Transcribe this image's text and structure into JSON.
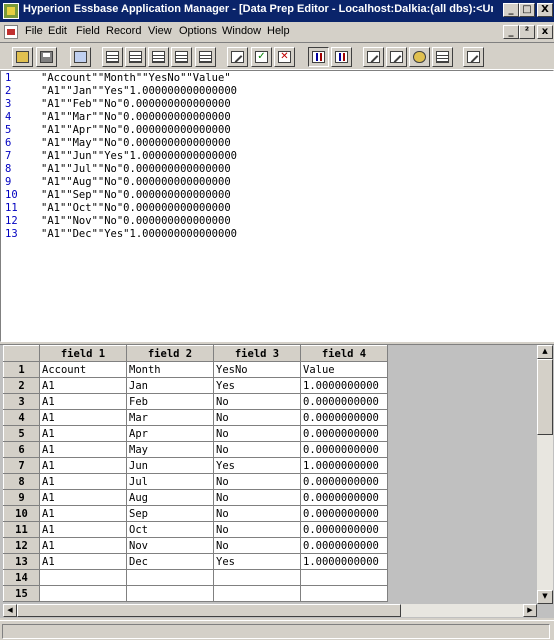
{
  "window": {
    "title": "Hyperion Essbase Application Manager - [Data Prep Editor - Localhost:Dalkia:(all dbs):<Untitle...",
    "controls": {
      "minimize": "_",
      "maximize": "□",
      "close": "X"
    }
  },
  "menubar": {
    "items": [
      "File",
      "Edit",
      "Field",
      "Record",
      "View",
      "Options",
      "Window",
      "Help"
    ],
    "mdi_controls": {
      "minimize": "_",
      "restore": "²",
      "close": "x"
    }
  },
  "toolbar": {
    "buttons": [
      {
        "name": "open-file-button",
        "icon": "open-icon"
      },
      {
        "name": "save-file-button",
        "icon": "save-icon"
      },
      {
        "name": "dimension-build-button",
        "icon": "filter-icon"
      },
      {
        "name": "record-view-button",
        "icon": "grid-icon"
      },
      {
        "name": "field-view-button",
        "icon": "grid-icon"
      },
      {
        "name": "column-view-button",
        "icon": "grid-icon"
      },
      {
        "name": "data-view-button",
        "icon": "grid-icon"
      },
      {
        "name": "edit-properties-button",
        "icon": "edit-icon"
      },
      {
        "name": "validate-button",
        "icon": "check-icon"
      },
      {
        "name": "clear-button",
        "icon": "x-icon"
      },
      {
        "name": "sort-button",
        "icon": "sort-icon"
      },
      {
        "name": "join-fields-button",
        "icon": "sort-icon"
      },
      {
        "name": "field-properties-button",
        "icon": "edit-icon"
      },
      {
        "name": "replace-button",
        "icon": "edit-icon"
      },
      {
        "name": "associate-outline-button",
        "icon": "gold-icon"
      },
      {
        "name": "data-load-settings-button",
        "icon": "grid-icon"
      },
      {
        "name": "help-button",
        "icon": "edit-icon"
      }
    ]
  },
  "text_pane": {
    "lines": [
      {
        "num": "1",
        "text": "\"Account\"\"Month\"\"YesNo\"\"Value\""
      },
      {
        "num": "2",
        "text": "\"A1\"\"Jan\"\"Yes\"1.000000000000000"
      },
      {
        "num": "3",
        "text": "\"A1\"\"Feb\"\"No\"0.000000000000000"
      },
      {
        "num": "4",
        "text": "\"A1\"\"Mar\"\"No\"0.000000000000000"
      },
      {
        "num": "5",
        "text": "\"A1\"\"Apr\"\"No\"0.000000000000000"
      },
      {
        "num": "6",
        "text": "\"A1\"\"May\"\"No\"0.000000000000000"
      },
      {
        "num": "7",
        "text": "\"A1\"\"Jun\"\"Yes\"1.000000000000000"
      },
      {
        "num": "8",
        "text": "\"A1\"\"Jul\"\"No\"0.000000000000000"
      },
      {
        "num": "9",
        "text": "\"A1\"\"Aug\"\"No\"0.000000000000000"
      },
      {
        "num": "10",
        "text": "\"A1\"\"Sep\"\"No\"0.000000000000000"
      },
      {
        "num": "11",
        "text": "\"A1\"\"Oct\"\"No\"0.000000000000000"
      },
      {
        "num": "12",
        "text": "\"A1\"\"Nov\"\"No\"0.000000000000000"
      },
      {
        "num": "13",
        "text": "\"A1\"\"Dec\"\"Yes\"1.000000000000000"
      }
    ]
  },
  "grid": {
    "columns": [
      "field 1",
      "field 2",
      "field 3",
      "field 4"
    ],
    "rows": [
      {
        "num": "1",
        "cells": [
          "Account",
          "Month",
          "YesNo",
          "Value"
        ]
      },
      {
        "num": "2",
        "cells": [
          "A1",
          "Jan",
          "Yes",
          "1.0000000000"
        ]
      },
      {
        "num": "3",
        "cells": [
          "A1",
          "Feb",
          "No",
          "0.0000000000"
        ]
      },
      {
        "num": "4",
        "cells": [
          "A1",
          "Mar",
          "No",
          "0.0000000000"
        ]
      },
      {
        "num": "5",
        "cells": [
          "A1",
          "Apr",
          "No",
          "0.0000000000"
        ]
      },
      {
        "num": "6",
        "cells": [
          "A1",
          "May",
          "No",
          "0.0000000000"
        ]
      },
      {
        "num": "7",
        "cells": [
          "A1",
          "Jun",
          "Yes",
          "1.0000000000"
        ]
      },
      {
        "num": "8",
        "cells": [
          "A1",
          "Jul",
          "No",
          "0.0000000000"
        ]
      },
      {
        "num": "9",
        "cells": [
          "A1",
          "Aug",
          "No",
          "0.0000000000"
        ]
      },
      {
        "num": "10",
        "cells": [
          "A1",
          "Sep",
          "No",
          "0.0000000000"
        ]
      },
      {
        "num": "11",
        "cells": [
          "A1",
          "Oct",
          "No",
          "0.0000000000"
        ]
      },
      {
        "num": "12",
        "cells": [
          "A1",
          "Nov",
          "No",
          "0.0000000000"
        ]
      },
      {
        "num": "13",
        "cells": [
          "A1",
          "Dec",
          "Yes",
          "1.0000000000"
        ]
      },
      {
        "num": "14",
        "cells": [
          "",
          "",
          "",
          ""
        ]
      },
      {
        "num": "15",
        "cells": [
          "",
          "",
          "",
          ""
        ]
      }
    ]
  },
  "colors": {
    "title_bar": "#0a246a",
    "line_number": "#0000c0",
    "chrome": "#d4d0c8"
  }
}
